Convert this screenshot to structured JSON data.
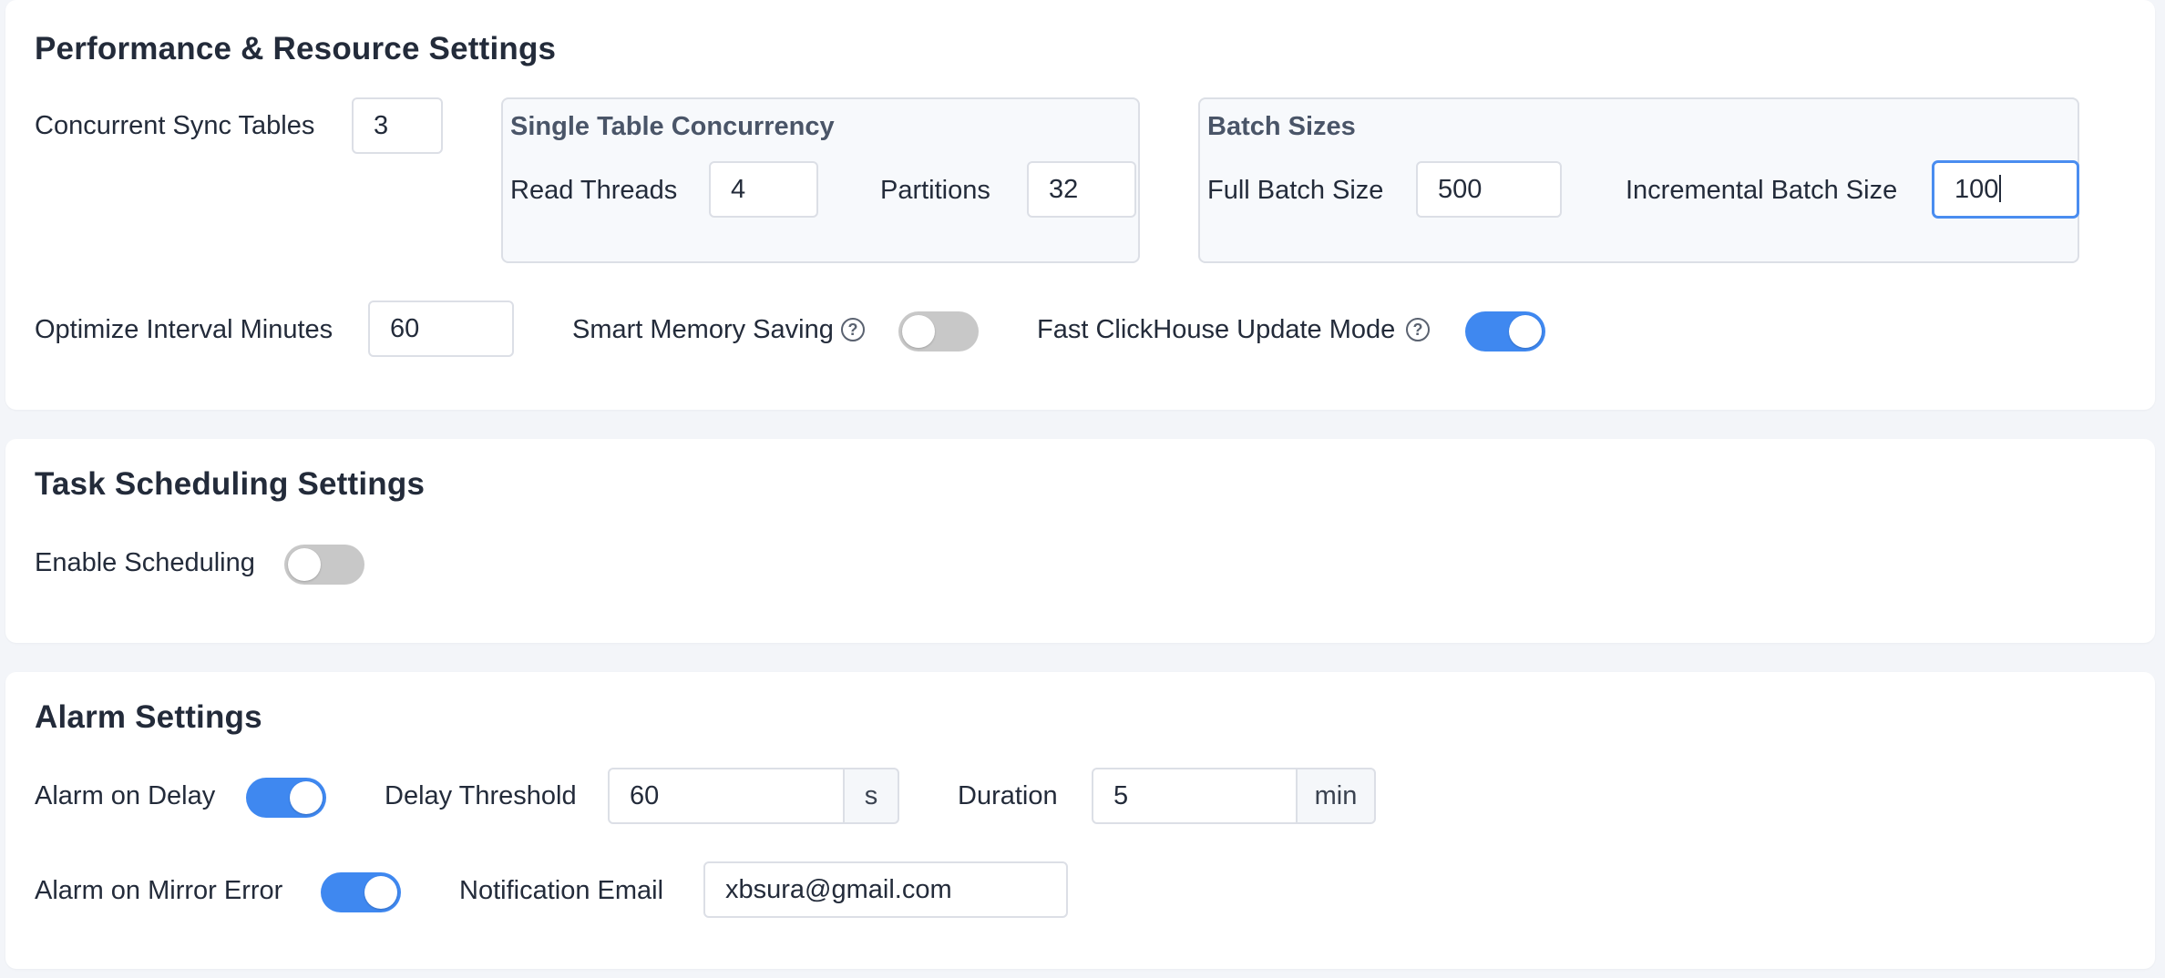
{
  "performance": {
    "title": "Performance & Resource Settings",
    "concurrent_sync_tables_label": "Concurrent Sync Tables",
    "concurrent_sync_tables_value": "3",
    "single_table": {
      "title": "Single Table Concurrency",
      "read_threads_label": "Read Threads",
      "read_threads_value": "4",
      "partitions_label": "Partitions",
      "partitions_value": "32"
    },
    "batch_sizes": {
      "title": "Batch Sizes",
      "full_label": "Full Batch Size",
      "full_value": "500",
      "incremental_label": "Incremental Batch Size",
      "incremental_value": "100"
    },
    "optimize_interval_label": "Optimize Interval Minutes",
    "optimize_interval_value": "60",
    "smart_memory_label": "Smart Memory Saving",
    "smart_memory_enabled": false,
    "fast_update_label": "Fast ClickHouse Update Mode",
    "fast_update_enabled": true,
    "help_glyph": "?"
  },
  "scheduling": {
    "title": "Task Scheduling Settings",
    "enable_label": "Enable Scheduling",
    "enabled": false
  },
  "alarm": {
    "title": "Alarm Settings",
    "on_delay_label": "Alarm on Delay",
    "on_delay_enabled": true,
    "delay_threshold_label": "Delay Threshold",
    "delay_threshold_value": "60",
    "delay_threshold_unit": "s",
    "duration_label": "Duration",
    "duration_value": "5",
    "duration_unit": "min",
    "mirror_error_label": "Alarm on Mirror Error",
    "mirror_error_enabled": true,
    "email_label": "Notification Email",
    "email_value": "xbsura@gmail.com"
  },
  "colors": {
    "accent": "#3f88f0",
    "toggle_off": "#c8c8c8",
    "background": "#f3f5f9"
  }
}
